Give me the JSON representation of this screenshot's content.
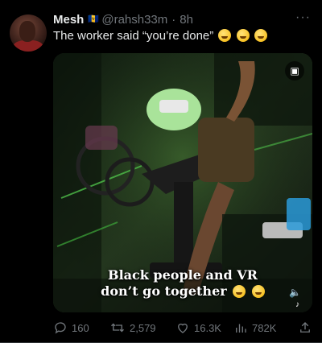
{
  "tweet": {
    "author_name": "Mesh",
    "author_flag": "🇧🇧",
    "handle": "@rahsh33m",
    "separator": "·",
    "time": "8h",
    "text": "The worker said “you’re done”",
    "more_label": "···"
  },
  "media": {
    "caption_line1": "Black people and VR",
    "caption_line2": "don’t go together",
    "alt_badge_icon": "image-settings-icon",
    "sound_icon": "volume-icon",
    "watermark_icon": "tiktok-logo-icon"
  },
  "actions": {
    "replies": "160",
    "retweets": "2,579",
    "likes": "16.3K",
    "views": "782K"
  },
  "colors": {
    "background": "#000000",
    "text_primary": "#e7e9ea",
    "text_secondary": "#71767b",
    "media_tint": "#1b261a"
  }
}
